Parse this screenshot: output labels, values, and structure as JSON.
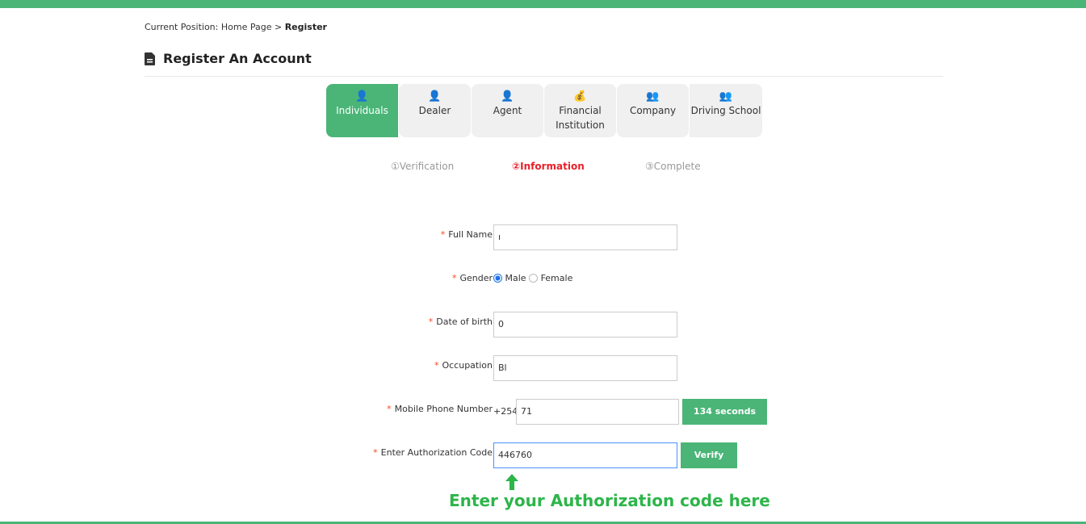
{
  "breadcrumb": {
    "prefix": "Current Position:",
    "home": "Home Page",
    "separator": ">",
    "current": "Register"
  },
  "page_title": "Register An Account",
  "account_types": [
    {
      "label": "Individuals",
      "icon": "user-icon",
      "active": true
    },
    {
      "label": "Dealer",
      "icon": "businessman-icon",
      "active": false
    },
    {
      "label": "Agent",
      "icon": "agent-icon",
      "active": false
    },
    {
      "label": "Financial Institution",
      "icon": "money-bag-icon",
      "active": false
    },
    {
      "label": "Company",
      "icon": "group-icon",
      "active": false
    },
    {
      "label": "Driving School",
      "icon": "group-icon",
      "active": false
    }
  ],
  "steps": [
    {
      "label": "①Verification",
      "state": "done"
    },
    {
      "label": "②Information",
      "state": "current"
    },
    {
      "label": "③Complete",
      "state": "pending"
    }
  ],
  "form": {
    "required_mark": "*",
    "full_name": {
      "label": "Full Name",
      "value": "ı"
    },
    "gender": {
      "label": "Gender",
      "options": [
        "Male",
        "Female"
      ],
      "selected": "Male"
    },
    "dob": {
      "label": "Date of birth",
      "value": "0"
    },
    "occupation": {
      "label": "Occupation",
      "value": "Bl"
    },
    "phone": {
      "label": "Mobile Phone Number",
      "prefix": "+254",
      "value": "71",
      "countdown": "134 seconds"
    },
    "auth_code": {
      "label": "Enter Authorization Code",
      "value": "446760",
      "verify": "Verify"
    }
  },
  "annotation": "Enter your Authorization code here",
  "colors": {
    "brand": "#4ab577",
    "current_step": "#e8202a",
    "annotation": "#2db54a"
  }
}
